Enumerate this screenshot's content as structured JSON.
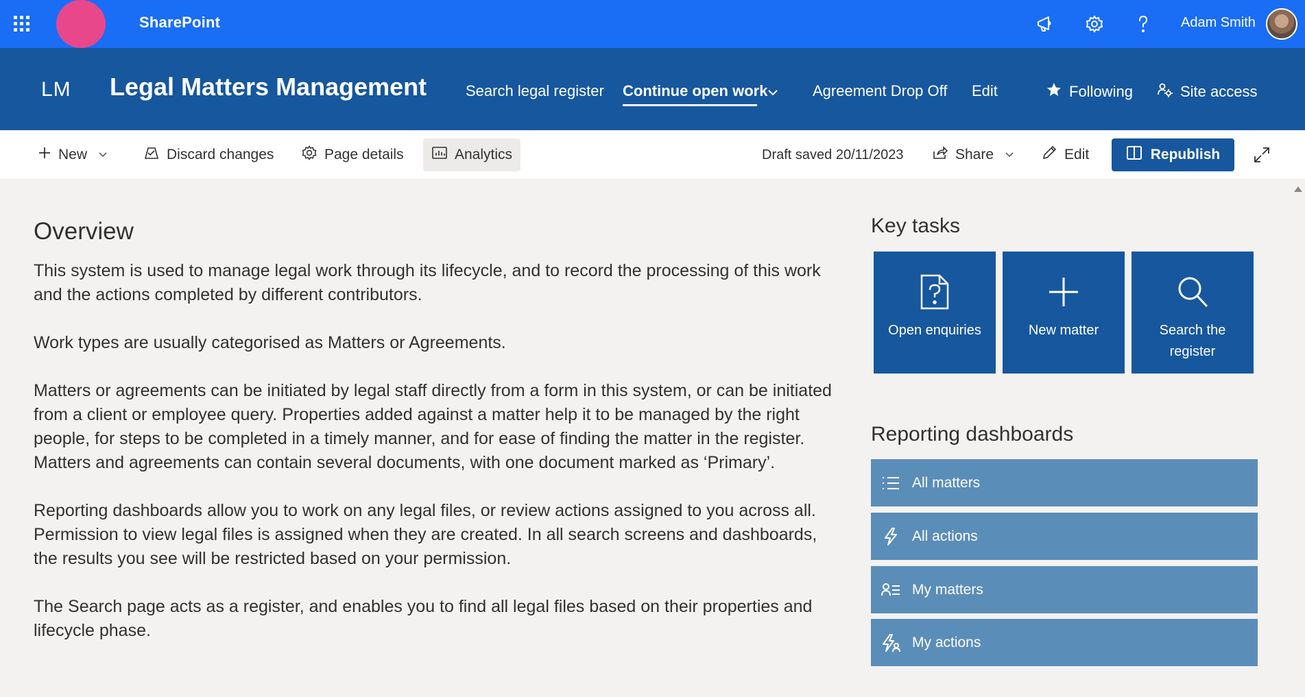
{
  "suite": {
    "app_name": "SharePoint",
    "user_name": "Adam Smith",
    "icons": [
      "app-launcher-icon",
      "megaphone-icon",
      "gear-icon",
      "help-icon"
    ]
  },
  "site": {
    "logo_text": "LM",
    "title": "Legal Matters Management",
    "nav": [
      {
        "label": "Search legal register"
      },
      {
        "label": "Continue open work",
        "active": true,
        "has_dropdown": true
      },
      {
        "label": "Agreement Drop Off"
      },
      {
        "label": "Edit"
      }
    ],
    "following_label": "Following",
    "site_access_label": "Site access"
  },
  "command_bar": {
    "new_label": "New",
    "discard_label": "Discard changes",
    "page_details_label": "Page details",
    "analytics_label": "Analytics",
    "draft_status": "Draft saved 20/11/2023",
    "share_label": "Share",
    "edit_label": "Edit",
    "republish_label": "Republish"
  },
  "overview": {
    "title": "Overview",
    "paragraphs": [
      "This system is used to manage legal work through its lifecycle, and to record the processing of this work and the actions completed by different contributors.",
      "Work types are usually categorised as Matters or Agreements.",
      "Matters or agreements can be initiated by legal staff directly from a form in this system, or can be initiated from a client or employee query.  Properties added against a matter help it to be managed by the right people, for steps to be completed in a timely manner, and for ease of finding the matter in the register. Matters and agreements can contain several documents, with one document marked as ‘Primary’.",
      "Reporting dashboards allow you to work on any legal files, or review actions assigned to you across all. Permission to view legal files is assigned when they are created. In all search screens and dashboards, the results you see will be restricted based on your permission.",
      "The Search page acts as a register, and enables you to find all legal files based on their properties and lifecycle phase."
    ]
  },
  "key_tasks": {
    "title": "Key tasks",
    "tiles": [
      {
        "label": "Open enquiries",
        "icon": "question-document-icon"
      },
      {
        "label": "New matter",
        "icon": "plus-icon"
      },
      {
        "label": "Search the register",
        "icon": "search-icon"
      }
    ]
  },
  "reporting": {
    "title": "Reporting dashboards",
    "items": [
      {
        "label": "All matters",
        "icon": "list-icon"
      },
      {
        "label": "All actions",
        "icon": "lightning-icon"
      },
      {
        "label": "My matters",
        "icon": "person-list-icon"
      },
      {
        "label": "My actions",
        "icon": "person-lightning-icon"
      }
    ]
  },
  "colors": {
    "suite_bar": "#1a6df5",
    "site_header": "#17579e",
    "brand_circle": "#e8478c",
    "tile": "#17579e",
    "dashboard_item": "#5b8db9",
    "page_bg": "#f3f2f1"
  }
}
